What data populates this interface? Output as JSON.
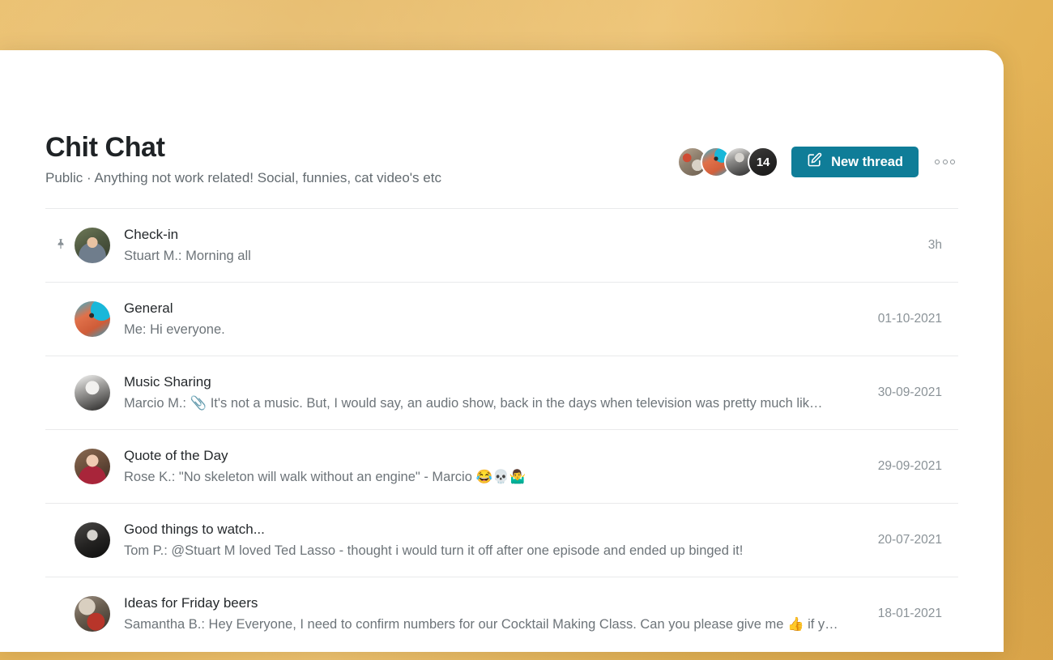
{
  "theme": {
    "background_gold": "#e6b75f",
    "card_background": "#ffffff",
    "accent_teal": "#0f7d98",
    "title_color": "#1f2326",
    "muted_color": "#6d7479",
    "divider_color": "#e9eaeb"
  },
  "header": {
    "title": "Chit Chat",
    "subtitle": "Public · Anything not work related! Social, funnies, cat video's etc",
    "members": {
      "overflow_count": "14",
      "avatars": [
        "member-avatar-1",
        "member-avatar-2",
        "member-avatar-3",
        "member-avatar-4"
      ]
    },
    "new_thread_label": "New thread",
    "new_thread_icon": "compose-pencil-icon",
    "more_menu_icon": "three-dots-icon"
  },
  "threads": [
    {
      "pinned": true,
      "pin_icon": "pushpin-icon",
      "avatar": "ra-stuart",
      "title": "Check-in",
      "preview": "Stuart M.: Morning all",
      "time": "3h"
    },
    {
      "pinned": false,
      "avatar": "ra-me",
      "title": "General",
      "preview": "Me: Hi everyone. 👋",
      "time": "01-10-2021",
      "clipped": true
    },
    {
      "pinned": false,
      "avatar": "ra-marcio",
      "title": "Music Sharing",
      "preview": "Marcio M.: 📎 It's not a music. But, I would say, an audio show, back in the days when television was pretty much lik…",
      "time": "30-09-2021"
    },
    {
      "pinned": false,
      "avatar": "ra-rose",
      "title": "Quote of the Day",
      "preview": "Rose K.: \"No skeleton will walk without an engine\" - Marcio 😂💀🤷‍♂️",
      "time": "29-09-2021"
    },
    {
      "pinned": false,
      "avatar": "ra-tom",
      "title": "Good things to watch...",
      "preview": "Tom P.: @Stuart M loved Ted Lasso - thought i would turn it off after one episode and ended up binged it!",
      "time": "20-07-2021"
    },
    {
      "pinned": false,
      "avatar": "ra-samantha",
      "title": "Ideas for Friday beers",
      "preview": "Samantha B.: Hey Everyone, I need to confirm numbers for our Cocktail Making Class. Can you please give me 👍 if y…",
      "time": "18-01-2021"
    }
  ]
}
